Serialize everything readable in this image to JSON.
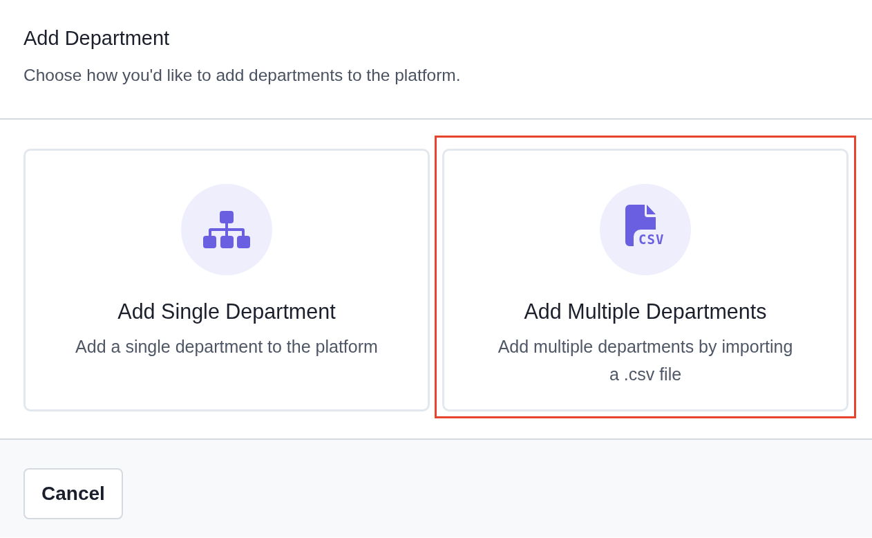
{
  "dialog": {
    "title": "Add Department",
    "subtitle": "Choose how you'd like to add departments to the platform."
  },
  "options": [
    {
      "kind": "org-chart",
      "title": "Add Single Department",
      "description": "Add a single department to the platform",
      "highlighted": false
    },
    {
      "kind": "csv-file",
      "icon_text": "CSV",
      "title": "Add Multiple Departments",
      "description": "Add multiple departments by importing a .csv file",
      "highlighted": true
    }
  ],
  "footer": {
    "cancel_button": "Cancel"
  }
}
